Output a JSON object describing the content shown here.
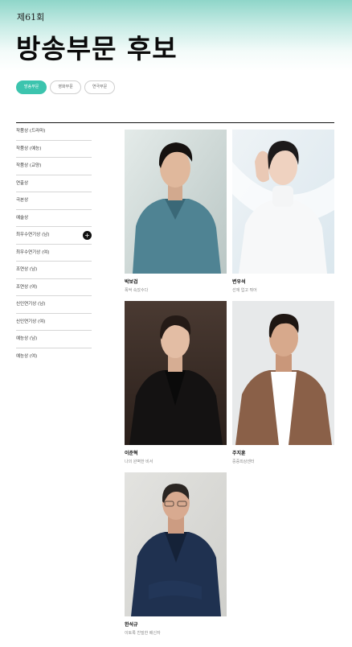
{
  "header": {
    "edition": "제61회",
    "title": "방송부문 후보"
  },
  "tabs": [
    {
      "label": "방송부문",
      "active": true
    },
    {
      "label": "영화부문",
      "active": false
    },
    {
      "label": "연극부문",
      "active": false
    }
  ],
  "sidebar": {
    "items": [
      {
        "label": "작품상 (드라마)"
      },
      {
        "label": "작품상 (예능)"
      },
      {
        "label": "작품상 (교양)"
      },
      {
        "label": "연출상"
      },
      {
        "label": "극본상"
      },
      {
        "label": "예술상"
      },
      {
        "label": "최우수연기상 (남)",
        "active": true,
        "marker": "+"
      },
      {
        "label": "최우수연기상 (여)"
      },
      {
        "label": "조연상 (남)"
      },
      {
        "label": "조연상 (여)"
      },
      {
        "label": "신인연기상 (남)"
      },
      {
        "label": "신인연기상 (여)"
      },
      {
        "label": "예능상 (남)"
      },
      {
        "label": "예능상 (여)"
      }
    ]
  },
  "nominees": [
    {
      "name": "박보검",
      "work": "폭싹 속았수다"
    },
    {
      "name": "변우석",
      "work": "선재 업고 튀어"
    },
    {
      "name": "이준혁",
      "work": "나의 완벽한 비서"
    },
    {
      "name": "주지훈",
      "work": "중증외상센터"
    },
    {
      "name": "한석규",
      "work": "이토록 친밀한 배신자"
    }
  ],
  "colors": {
    "accent": "#3cc4ae",
    "hero_top": "#8fd6c9"
  }
}
